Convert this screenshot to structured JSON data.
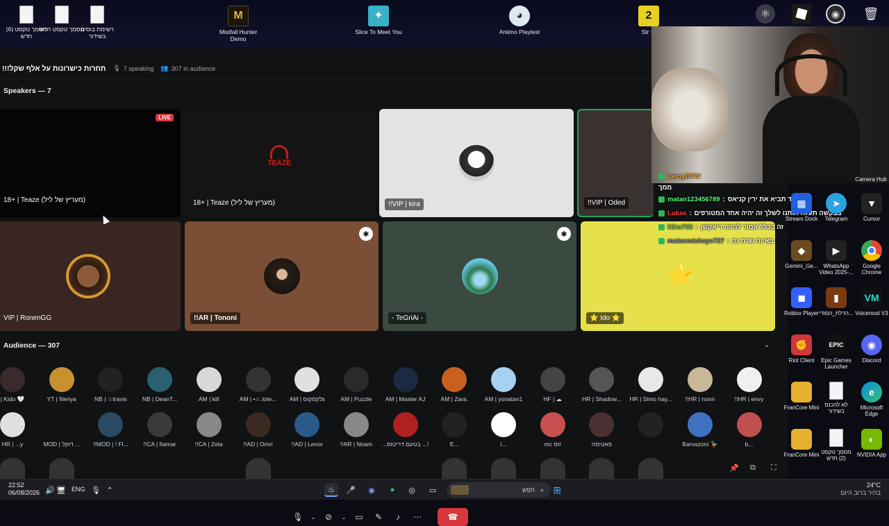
{
  "desktop_top": {
    "icons": [
      {
        "label": "מסמך טקסט (6) חדש"
      },
      {
        "label": "מסמך טקסט חדש"
      },
      {
        "label": "רשימת בוסים בשידור"
      },
      {
        "label": "Mistfall Hunter Demo"
      },
      {
        "label": "Slice To Meet You"
      },
      {
        "label": "Aniimo Playtest"
      },
      {
        "label": "Str Si"
      }
    ]
  },
  "stage": {
    "title": "!!!תחרות כישרונות על אלף שקל",
    "speaking": "7 speaking",
    "audience_count": "307 in audience",
    "speakers_header": "Speakers — 7",
    "audience_header": "Audience — 307",
    "live_badge": "LIVE",
    "speakers": [
      {
        "name": "18+ | Teaze (מעריץ של ליל)"
      },
      {
        "name": "18+ | Teaze (מעריץ של ליל)",
        "logo": "TEAZE"
      },
      {
        "name": "!!VIP | kira"
      },
      {
        "name": "!!VIP | Oded"
      },
      {
        "name": "VIP | RonenGG"
      },
      {
        "name": "!!AR | Tononi"
      },
      {
        "name": "- TeGriAi -"
      },
      {
        "name": "⭐ Ido ⭐"
      }
    ],
    "audience_row1": [
      "| Kido 🤍",
      "YT | Neriya",
      "NB | ☆travis",
      "NB | DeanT...",
      "AM | kill",
      "AM | •☆.lote...",
      "AM | גלקסקוס",
      "AM | Puzzle",
      "AM | Master AJ",
      "AM | Zara.",
      "AM | yonatan1",
      "HF | ☁",
      "HR | Shadow...",
      "HR | Simo hay...",
      "!!HR | nonn",
      "!!HR | envy"
    ],
    "audience_row2": [
      "HR | ...y",
      "MOD | דוקל ...",
      "!!MOD | ! Fl...",
      "!!CA | Itamar",
      "!!CA | Zeta",
      "!!AD | Omri",
      "!!AD | Lenor",
      "!!AR | Noam",
      "...בטעם דריטוס ...!",
      "E...",
      "i...",
      "mc סri",
      "פאטימה",
      "",
      "Barvazoni 🦆",
      "b..."
    ]
  },
  "chat": {
    "lines": [
      {
        "user": "LeroyDTW",
        "color": "#ffb347",
        "text": "ממך"
      },
      {
        "user": "matan123456789",
        "color": "#5dff7a",
        "text": "עודד תביא את ירין קניאס"
      },
      {
        "user": "Lukas",
        "color": "#ff4040",
        "text": "בבקשה תעלה אותנו לשלך זה יהיה אחד המטורפים"
      },
      {
        "user": "Niko768",
        "color": "#8fd16a",
        "text": "זה בכלל אמור להיות ריאקשן"
      },
      {
        "user": "matanmishaye727",
        "color": "#8a8f9a",
        "text": "באיזה שרת זה"
      }
    ]
  },
  "right_icons": [
    {
      "label": "Camera Hub"
    },
    {
      "label": "Stream Dock"
    },
    {
      "label": "Telegram"
    },
    {
      "label": "Cursor"
    },
    {
      "label": "Gemini_Ge..."
    },
    {
      "label": "WhatsApp Video 2025-..."
    },
    {
      "label": "Google Chrome"
    },
    {
      "label": "Roblox Player"
    },
    {
      "label": "הדלת_הסודי..."
    },
    {
      "label": "Voicemod V3"
    },
    {
      "label": "Riot Client"
    },
    {
      "label": "Epic Games Launcher"
    },
    {
      "label": "Discord"
    },
    {
      "label": "FranCore Mini"
    },
    {
      "label": "לא להכנס בשידור"
    },
    {
      "label": "Microsoft Edge"
    },
    {
      "label": "FranCore Mini"
    },
    {
      "label": "מסמך טקסט (2) חדש"
    },
    {
      "label": "NVIDIA App"
    }
  ],
  "taskbar": {
    "time": "22:52",
    "date": "06/08/2026",
    "lang": "ENG",
    "search_placeholder": "חפש",
    "weather_temp": "24°C",
    "weather_desc": "בהיר ברוב היום"
  },
  "colors": {
    "discord_red": "#da373c",
    "speaking_green": "#23a55a"
  }
}
